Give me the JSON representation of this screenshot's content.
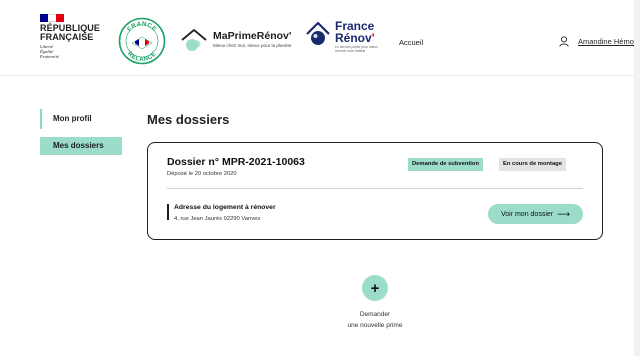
{
  "header": {
    "republique": {
      "name_line1": "RÉPUBLIQUE",
      "name_line2": "FRANÇAISE",
      "motto": [
        "Liberté",
        "Égalité",
        "Fraternité"
      ],
      "flag_colors": [
        "#000091",
        "#ffffff",
        "#e1000f"
      ]
    },
    "france_relance": {
      "text_top": "FRANCE",
      "text_bottom": "RELANCE",
      "accent": "#1ba263"
    },
    "maprimerenov": {
      "name": "MaPrimeRénov'",
      "tagline": "Mieux chez moi, mieux pour la planète"
    },
    "france_renov": {
      "line1": "France",
      "line2": "Rénov",
      "line2_accent": "'",
      "subtitle": "Le service public pour mieux rénover mon habitat"
    },
    "nav_accueil": "Accueil",
    "user_name": "Amandine Hémon"
  },
  "sidebar": {
    "items": [
      {
        "label": "Mon profil",
        "active": false
      },
      {
        "label": "Mes dossiers",
        "active": true
      }
    ]
  },
  "main": {
    "title": "Mes dossiers",
    "dossier": {
      "title": "Dossier n° MPR-2021-10063",
      "date": "Déposé le 20 octobre 2020",
      "badge_type": "Demande de subvention",
      "badge_status": "En cours de montage",
      "address_label": "Adresse du logement à rénover",
      "address_value": "4, rue Jean Jaurès 92290 Vanves",
      "button_label": "Voir mon dossier",
      "button_arrow": "⟶"
    },
    "new_request": {
      "plus": "+",
      "line1": "Demander",
      "line2": "une nouvelle prime"
    }
  },
  "colors": {
    "accent": "#9bdccb",
    "badge_grey": "#e3e3e3",
    "text": "#1e1e1e",
    "france_renov_blue": "#1a2b6d",
    "france_renov_red": "#e1000f"
  },
  "icons": {
    "user": "user-icon",
    "arrow": "arrow-right-icon",
    "plus": "plus-icon"
  }
}
